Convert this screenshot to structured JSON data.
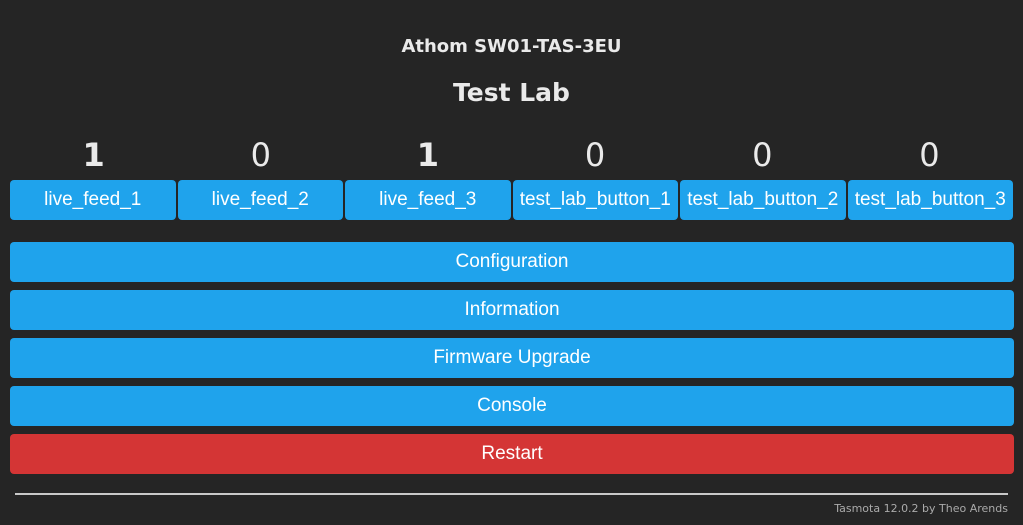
{
  "header": {
    "device_name": "Athom SW01-TAS-3EU",
    "title": "Test Lab"
  },
  "relays": [
    {
      "state": "1",
      "label": "live_feed_1"
    },
    {
      "state": "0",
      "label": "live_feed_2"
    },
    {
      "state": "1",
      "label": "live_feed_3"
    },
    {
      "state": "0",
      "label": "test_lab_button_1"
    },
    {
      "state": "0",
      "label": "test_lab_button_2"
    },
    {
      "state": "0",
      "label": "test_lab_button_3"
    }
  ],
  "menu": {
    "configuration": "Configuration",
    "information": "Information",
    "firmware_upgrade": "Firmware Upgrade",
    "console": "Console",
    "restart": "Restart"
  },
  "colors": {
    "background": "#252525",
    "button": "#1fa3ec",
    "danger_button": "#d43535",
    "text": "#eaeaea"
  },
  "footer": {
    "text": "Tasmota 12.0.2 by Theo Arends"
  }
}
